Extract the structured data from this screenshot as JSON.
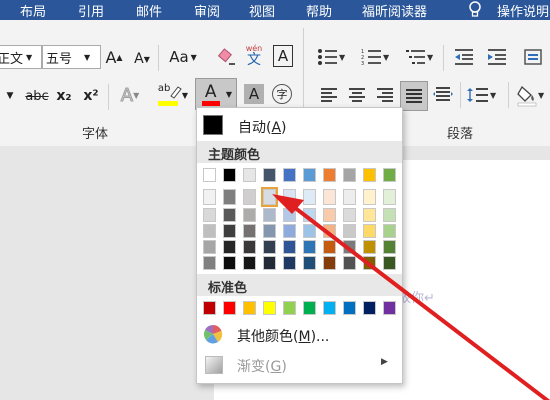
{
  "tabs": [
    {
      "label": "布局"
    },
    {
      "label": "引用"
    },
    {
      "label": "邮件"
    },
    {
      "label": "审阅"
    },
    {
      "label": "视图"
    },
    {
      "label": "帮助"
    },
    {
      "label": "福昕阅读器"
    },
    {
      "label": "操作说明"
    }
  ],
  "font": {
    "family_value": "正文",
    "size_value": "五号",
    "grow_label": "A",
    "shrink_label": "A",
    "change_case_label": "Aa",
    "phonetic_label": "wén",
    "phonetic_char": "文",
    "border_label": "A",
    "strike_label": "abc",
    "sub_label": "x₂",
    "sup_label": "x²",
    "effects_label": "A",
    "highlight_label": "ab",
    "font_color_label": "A",
    "shading_label": "A",
    "enclose_label": "字",
    "group_label": "字体"
  },
  "paragraph": {
    "group_label": "段落"
  },
  "menu": {
    "auto_label": "自动(",
    "auto_key": "A",
    "auto_close": ")",
    "theme_header": "主题颜色",
    "standard_header": "标准色",
    "more_label": "其他颜色(",
    "more_key": "M",
    "more_close": ")...",
    "gradient_label": "渐变(",
    "gradient_key": "G",
    "gradient_close": ")"
  },
  "theme_colors": [
    [
      "#ffffff",
      "#f2f2f2",
      "#d9d9d9",
      "#bfbfbf",
      "#a6a6a6",
      "#808080"
    ],
    [
      "#000000",
      "#7f7f7f",
      "#595959",
      "#3f3f3f",
      "#262626",
      "#0d0d0d"
    ],
    [
      "#e7e6e6",
      "#d0cece",
      "#aeabab",
      "#757171",
      "#3a3838",
      "#171616"
    ],
    [
      "#44546a",
      "#d6dce4",
      "#adb9ca",
      "#8496b0",
      "#333f50",
      "#222a35"
    ],
    [
      "#4472c4",
      "#dae3f3",
      "#b4c7e7",
      "#8faadc",
      "#2f5597",
      "#203864"
    ],
    [
      "#5b9bd5",
      "#deebf7",
      "#bdd7ee",
      "#9dc3e6",
      "#2e75b6",
      "#1f4e79"
    ],
    [
      "#ed7d31",
      "#fbe5d6",
      "#f8cbad",
      "#f4b183",
      "#c55a11",
      "#843c0c"
    ],
    [
      "#a5a5a5",
      "#ededed",
      "#dbdbdb",
      "#c9c9c9",
      "#7b7b7b",
      "#525252"
    ],
    [
      "#ffc000",
      "#fff2cc",
      "#ffe699",
      "#ffd966",
      "#bf9000",
      "#7f6000"
    ],
    [
      "#70ad47",
      "#e2f0d9",
      "#c5e0b4",
      "#a9d18e",
      "#548235",
      "#385723"
    ]
  ],
  "standard_colors": [
    "#c00000",
    "#ff0000",
    "#ffc000",
    "#ffff00",
    "#92d050",
    "#00b050",
    "#00b0f0",
    "#0070c0",
    "#002060",
    "#7030a0"
  ],
  "doc": {
    "ghost_text": "故你↵"
  },
  "colors": {
    "tab_bg": "#2b579a",
    "arrow": "#e02020",
    "highlight": "#e8a33c"
  }
}
